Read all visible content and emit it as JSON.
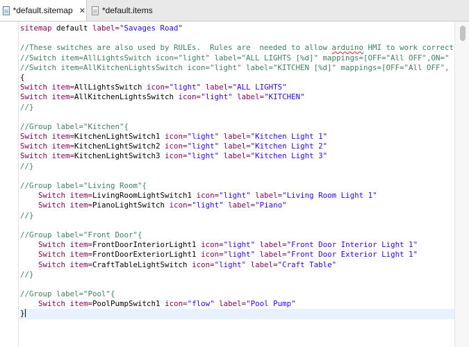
{
  "tabs": [
    {
      "label": "*default.sitemap",
      "active": true,
      "close": "✕"
    },
    {
      "label": "*default.items",
      "active": false
    }
  ],
  "code_lines": [
    {
      "segs": [
        {
          "t": "sitemap ",
          "c": "kw"
        },
        {
          "t": "default ",
          "c": ""
        },
        {
          "t": "label=",
          "c": "kw"
        },
        {
          "t": "\"Savages Road\"",
          "c": "str"
        }
      ]
    },
    {
      "segs": []
    },
    {
      "segs": [
        {
          "t": "//These switches are also used by RULEs.  Rules are  needed to allow ",
          "c": "cm"
        },
        {
          "t": "arduino",
          "c": "cm sq"
        },
        {
          "t": " HMI to work correct",
          "c": "cm"
        }
      ]
    },
    {
      "segs": [
        {
          "t": "//Switch item=AllLightsSwitch icon=\"light\" label=\"ALL LIGHTS [%d]\" mappings=[OFF=\"All OFF\",ON=\"",
          "c": "cm"
        }
      ]
    },
    {
      "segs": [
        {
          "t": "//Switch item=AllKitchenLightsSwitch icon=\"light\" label=\"KITCHEN [%d]\" mappings=[OFF=\"All OFF\",",
          "c": "cm"
        }
      ]
    },
    {
      "segs": [
        {
          "t": "{",
          "c": ""
        }
      ]
    },
    {
      "segs": [
        {
          "t": "Switch ",
          "c": "kw"
        },
        {
          "t": "item=",
          "c": "kw"
        },
        {
          "t": "AllLightsSwitch ",
          "c": ""
        },
        {
          "t": "icon=",
          "c": "kw"
        },
        {
          "t": "\"light\" ",
          "c": "str"
        },
        {
          "t": "label=",
          "c": "kw"
        },
        {
          "t": "\"ALL LIGHTS\"",
          "c": "str"
        }
      ]
    },
    {
      "segs": [
        {
          "t": "Switch ",
          "c": "kw"
        },
        {
          "t": "item=",
          "c": "kw"
        },
        {
          "t": "AllKitchenLightsSwitch ",
          "c": ""
        },
        {
          "t": "icon=",
          "c": "kw"
        },
        {
          "t": "\"light\" ",
          "c": "str"
        },
        {
          "t": "label=",
          "c": "kw"
        },
        {
          "t": "\"KITCHEN\"",
          "c": "str"
        }
      ]
    },
    {
      "segs": [
        {
          "t": "//}",
          "c": "cm"
        }
      ]
    },
    {
      "segs": []
    },
    {
      "segs": [
        {
          "t": "//Group label=\"Kitchen\"{",
          "c": "cm"
        }
      ]
    },
    {
      "segs": [
        {
          "t": "Switch ",
          "c": "kw"
        },
        {
          "t": "item=",
          "c": "kw"
        },
        {
          "t": "KitchenLightSwitch1 ",
          "c": ""
        },
        {
          "t": "icon=",
          "c": "kw"
        },
        {
          "t": "\"light\" ",
          "c": "str"
        },
        {
          "t": "label=",
          "c": "kw"
        },
        {
          "t": "\"Kitchen Light 1\"",
          "c": "str"
        }
      ]
    },
    {
      "segs": [
        {
          "t": "Switch ",
          "c": "kw"
        },
        {
          "t": "item=",
          "c": "kw"
        },
        {
          "t": "KitchenLightSwitch2 ",
          "c": ""
        },
        {
          "t": "icon=",
          "c": "kw"
        },
        {
          "t": "\"light\" ",
          "c": "str"
        },
        {
          "t": "label=",
          "c": "kw"
        },
        {
          "t": "\"Kitchen Light 2\"",
          "c": "str"
        }
      ]
    },
    {
      "segs": [
        {
          "t": "Switch ",
          "c": "kw"
        },
        {
          "t": "item=",
          "c": "kw"
        },
        {
          "t": "KitchenLightSwitch3 ",
          "c": ""
        },
        {
          "t": "icon=",
          "c": "kw"
        },
        {
          "t": "\"light\" ",
          "c": "str"
        },
        {
          "t": "label=",
          "c": "kw"
        },
        {
          "t": "\"Kitchen Light 3\"",
          "c": "str"
        }
      ]
    },
    {
      "segs": [
        {
          "t": "//}",
          "c": "cm"
        }
      ]
    },
    {
      "segs": []
    },
    {
      "segs": [
        {
          "t": "//Group label=\"Living Room\"{",
          "c": "cm"
        }
      ]
    },
    {
      "segs": [
        {
          "t": "    ",
          "c": ""
        },
        {
          "t": "Switch ",
          "c": "kw"
        },
        {
          "t": "item=",
          "c": "kw"
        },
        {
          "t": "LivingRoomLightSwitch1 ",
          "c": ""
        },
        {
          "t": "icon=",
          "c": "kw"
        },
        {
          "t": "\"light\" ",
          "c": "str"
        },
        {
          "t": "label=",
          "c": "kw"
        },
        {
          "t": "\"Living Room Light 1\"",
          "c": "str"
        }
      ]
    },
    {
      "segs": [
        {
          "t": "    ",
          "c": ""
        },
        {
          "t": "Switch ",
          "c": "kw"
        },
        {
          "t": "item=",
          "c": "kw"
        },
        {
          "t": "PianoLightSwitch ",
          "c": ""
        },
        {
          "t": "icon=",
          "c": "kw"
        },
        {
          "t": "\"light\" ",
          "c": "str"
        },
        {
          "t": "label=",
          "c": "kw"
        },
        {
          "t": "\"Piano\"",
          "c": "str"
        }
      ]
    },
    {
      "segs": [
        {
          "t": "//}",
          "c": "cm"
        }
      ]
    },
    {
      "segs": []
    },
    {
      "segs": [
        {
          "t": "//Group label=\"Front Door\"{",
          "c": "cm"
        }
      ]
    },
    {
      "segs": [
        {
          "t": "    ",
          "c": ""
        },
        {
          "t": "Switch ",
          "c": "kw"
        },
        {
          "t": "item=",
          "c": "kw"
        },
        {
          "t": "FrontDoorInteriorLight1 ",
          "c": ""
        },
        {
          "t": "icon=",
          "c": "kw"
        },
        {
          "t": "\"light\" ",
          "c": "str"
        },
        {
          "t": "label=",
          "c": "kw"
        },
        {
          "t": "\"Front Door Interior Light 1\"",
          "c": "str"
        }
      ]
    },
    {
      "segs": [
        {
          "t": "    ",
          "c": ""
        },
        {
          "t": "Switch ",
          "c": "kw"
        },
        {
          "t": "item=",
          "c": "kw"
        },
        {
          "t": "FrontDoorExteriorLight1 ",
          "c": ""
        },
        {
          "t": "icon=",
          "c": "kw"
        },
        {
          "t": "\"light\" ",
          "c": "str"
        },
        {
          "t": "label=",
          "c": "kw"
        },
        {
          "t": "\"Front Door Exterior Light 1\"",
          "c": "str"
        }
      ]
    },
    {
      "segs": [
        {
          "t": "    ",
          "c": ""
        },
        {
          "t": "Switch ",
          "c": "kw"
        },
        {
          "t": "item=",
          "c": "kw"
        },
        {
          "t": "CraftTableLightSwitch ",
          "c": ""
        },
        {
          "t": "icon=",
          "c": "kw"
        },
        {
          "t": "\"light\" ",
          "c": "str"
        },
        {
          "t": "label=",
          "c": "kw"
        },
        {
          "t": "\"Craft Table\"",
          "c": "str"
        }
      ]
    },
    {
      "segs": [
        {
          "t": "//}",
          "c": "cm"
        }
      ]
    },
    {
      "segs": []
    },
    {
      "segs": [
        {
          "t": "//Group label=\"Pool\"{",
          "c": "cm"
        }
      ]
    },
    {
      "segs": [
        {
          "t": "    ",
          "c": ""
        },
        {
          "t": "Switch ",
          "c": "kw"
        },
        {
          "t": "item=",
          "c": "kw"
        },
        {
          "t": "PoolPumpSwitch1 ",
          "c": ""
        },
        {
          "t": "icon=",
          "c": "kw"
        },
        {
          "t": "\"flow\" ",
          "c": "str"
        },
        {
          "t": "label=",
          "c": "kw"
        },
        {
          "t": "\"Pool Pump\"",
          "c": "str"
        }
      ]
    },
    {
      "segs": [
        {
          "t": "}",
          "c": ""
        }
      ],
      "current": true
    }
  ],
  "colors": {
    "keyword": "#7f0055",
    "comment": "#3f7f5f",
    "string": "#2a00ff",
    "current_line": "#e8f2fe"
  }
}
